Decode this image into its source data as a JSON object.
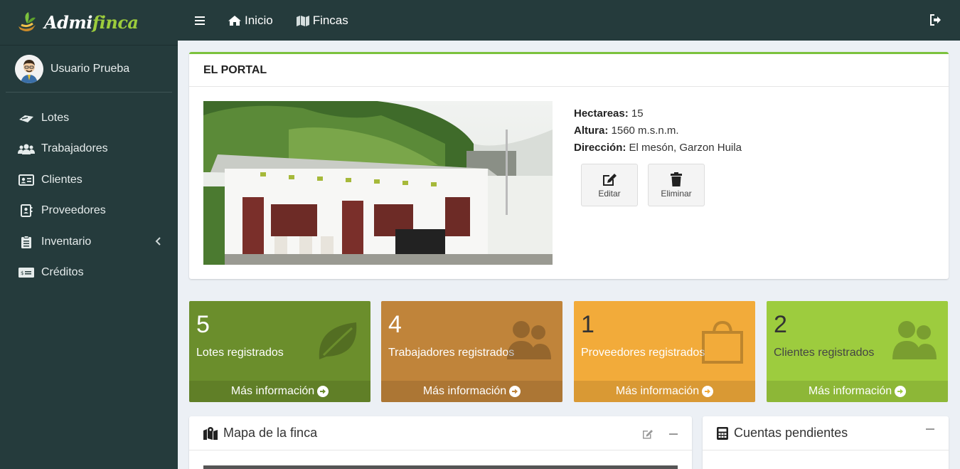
{
  "app": {
    "logo_text_a": "Admi",
    "logo_text_b": "finca"
  },
  "user": {
    "name": "Usuario Prueba"
  },
  "sidebar": {
    "items": [
      {
        "label": "Lotes",
        "icon": "leaf-hand-icon"
      },
      {
        "label": "Trabajadores",
        "icon": "users-icon"
      },
      {
        "label": "Clientes",
        "icon": "id-card-icon"
      },
      {
        "label": "Proveedores",
        "icon": "address-book-icon"
      },
      {
        "label": "Inventario",
        "icon": "clipboard-icon"
      },
      {
        "label": "Créditos",
        "icon": "money-icon"
      }
    ]
  },
  "topbar": {
    "home": "Inicio",
    "farms": "Fincas"
  },
  "farm": {
    "title": "EL PORTAL",
    "hectares_label": "Hectareas:",
    "hectares_value": "15",
    "altitude_label": "Altura:",
    "altitude_value": "1560 m.s.n.m.",
    "address_label": "Dirección:",
    "address_value": "El mesón, Garzon Huila",
    "edit_label": "Editar",
    "delete_label": "Eliminar"
  },
  "stats": [
    {
      "count": "5",
      "label": "Lotes registrados",
      "more": "Más información",
      "color": "#6b8e2c"
    },
    {
      "count": "4",
      "label": "Trabajadores registrados",
      "more": "Más información",
      "color": "#c0843a"
    },
    {
      "count": "1",
      "label": "Proveedores registrados",
      "more": "Más información",
      "color": "#f2ab3a"
    },
    {
      "count": "2",
      "label": "Clientes registrados",
      "more": "Más información",
      "color": "#9dcc3e"
    }
  ],
  "panels": {
    "map_title": "Mapa de la finca",
    "accounts_title": "Cuentas pendientes"
  }
}
